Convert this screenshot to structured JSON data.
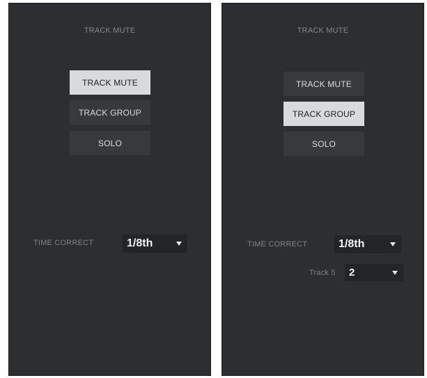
{
  "left_panel": {
    "title": "TRACK MUTE",
    "modes": [
      {
        "label": "TRACK MUTE",
        "active": true
      },
      {
        "label": "TRACK GROUP",
        "active": false
      },
      {
        "label": "SOLO",
        "active": false
      }
    ],
    "time_correct": {
      "label": "TIME CORRECT",
      "value": "1/8th"
    }
  },
  "right_panel": {
    "title": "TRACK MUTE",
    "modes": [
      {
        "label": "TRACK MUTE",
        "active": false
      },
      {
        "label": "TRACK GROUP",
        "active": true
      },
      {
        "label": "SOLO",
        "active": false
      }
    ],
    "time_correct": {
      "label": "TIME CORRECT",
      "value": "1/8th"
    },
    "track": {
      "label": "Track 5",
      "value": "2"
    }
  },
  "colors": {
    "panel_bg": "#2d2e30",
    "button_bg": "#38393c",
    "button_active_bg": "#d9dadc",
    "select_bg": "#232426",
    "label_text": "#7f8185"
  },
  "icons": {
    "dropdown": "caret-down-icon"
  }
}
